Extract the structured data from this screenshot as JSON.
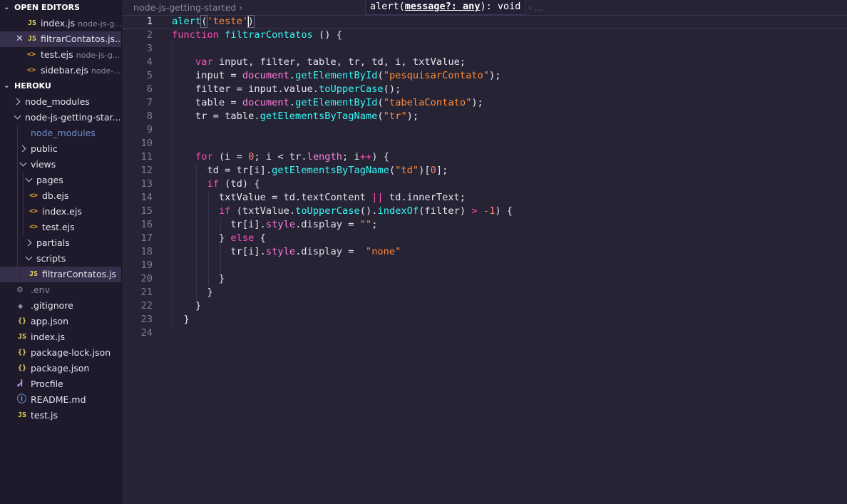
{
  "sidebar": {
    "open_editors": {
      "title": "OPEN EDITORS",
      "items": [
        {
          "icon": "JS",
          "name": "index.js",
          "desc": "node-js-g..."
        },
        {
          "icon": "JS",
          "name": "filtrarContatos.js...",
          "desc": ""
        },
        {
          "icon": "<>",
          "name": "test.ejs",
          "desc": "node-js-g..."
        },
        {
          "icon": "<>",
          "name": "sidebar.ejs",
          "desc": "node-..."
        }
      ]
    },
    "explorer": {
      "title": "HEROKU",
      "items": [
        {
          "name": "node_modules"
        },
        {
          "name": "node-js-getting-star..."
        },
        {
          "name": "node_modules"
        },
        {
          "name": "public"
        },
        {
          "name": "views"
        },
        {
          "name": "pages"
        },
        {
          "icon": "<>",
          "name": "db.ejs"
        },
        {
          "icon": "<>",
          "name": "index.ejs"
        },
        {
          "icon": "<>",
          "name": "test.ejs"
        },
        {
          "name": "partials"
        },
        {
          "name": "scripts"
        },
        {
          "icon": "JS",
          "name": "filtrarContatos.js"
        },
        {
          "icon": "⚙",
          "name": ".env"
        },
        {
          "icon": "◆",
          "name": ".gitignore"
        },
        {
          "icon": "{}",
          "name": "app.json"
        },
        {
          "icon": "JS",
          "name": "index.js"
        },
        {
          "icon": "{}",
          "name": "package-lock.json"
        },
        {
          "icon": "{}",
          "name": "package.json"
        },
        {
          "icon": "Ꮧ",
          "name": "Procfile"
        },
        {
          "icon": "ⓘ",
          "name": "README.md"
        },
        {
          "icon": "JS",
          "name": "test.js"
        }
      ]
    }
  },
  "editor": {
    "breadcrumb": "node-js-getting-started",
    "tooltip": {
      "fn": "alert(",
      "param": "message?: any",
      "rest": "): void",
      "tail": "› …"
    },
    "lines": [
      "1",
      "2",
      "3",
      "4",
      "5",
      "6",
      "7",
      "8",
      "9",
      "10",
      "11",
      "12",
      "13",
      "14",
      "15",
      "16",
      "17",
      "18",
      "19",
      "20",
      "21",
      "22",
      "23",
      "24"
    ]
  },
  "colors": {
    "sidebar_bg": "#1e1a2c",
    "editor_bg": "#262335",
    "keyword": "#fe4eb8",
    "function": "#36f9f6",
    "string": "#ff8b39",
    "number": "#f97e72"
  }
}
